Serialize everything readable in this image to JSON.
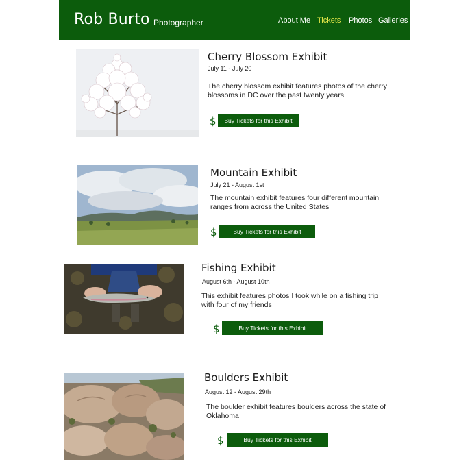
{
  "header": {
    "name": "Rob Burto",
    "tagline": "Photographer",
    "nav": [
      {
        "label": "About Me"
      },
      {
        "label": "Tickets"
      },
      {
        "label": "Photos"
      },
      {
        "label": "Galleries"
      }
    ],
    "active_nav": "Tickets"
  },
  "exhibits": [
    {
      "title": "Cherry Blossom Exhibit",
      "dates": "July 11 - July 20",
      "description": "The cherry blossom exhibit features photos of the cherry blossoms in DC over the past twenty years",
      "button": "Buy Tickets for this Exhibit",
      "icon": "dollar-icon"
    },
    {
      "title": "Mountain Exhibit",
      "dates": "July 21 - August 1st",
      "description": "The mountain exhibit features four different mountain ranges from across the United States",
      "button": "Buy Tickets for this Exhibit",
      "icon": "dollar-icon"
    },
    {
      "title": "Fishing Exhibit",
      "dates": "August 6th - August 10th",
      "description": "This exhibit features photos I took while on a fishing trip with four of my friends",
      "button": "Buy Tickets for this Exhibit",
      "icon": "dollar-icon"
    },
    {
      "title": "Boulders Exhibit",
      "dates": "August 12 - August 29th",
      "description": "The boulder exhibit features boulders across the state of Oklahoma",
      "button": "Buy Tickets for this Exhibit",
      "icon": "dollar-icon"
    }
  ],
  "colors": {
    "header_bg": "#0c5c0c",
    "active_nav": "#e6e84a",
    "button_bg": "#0c5c0c"
  }
}
